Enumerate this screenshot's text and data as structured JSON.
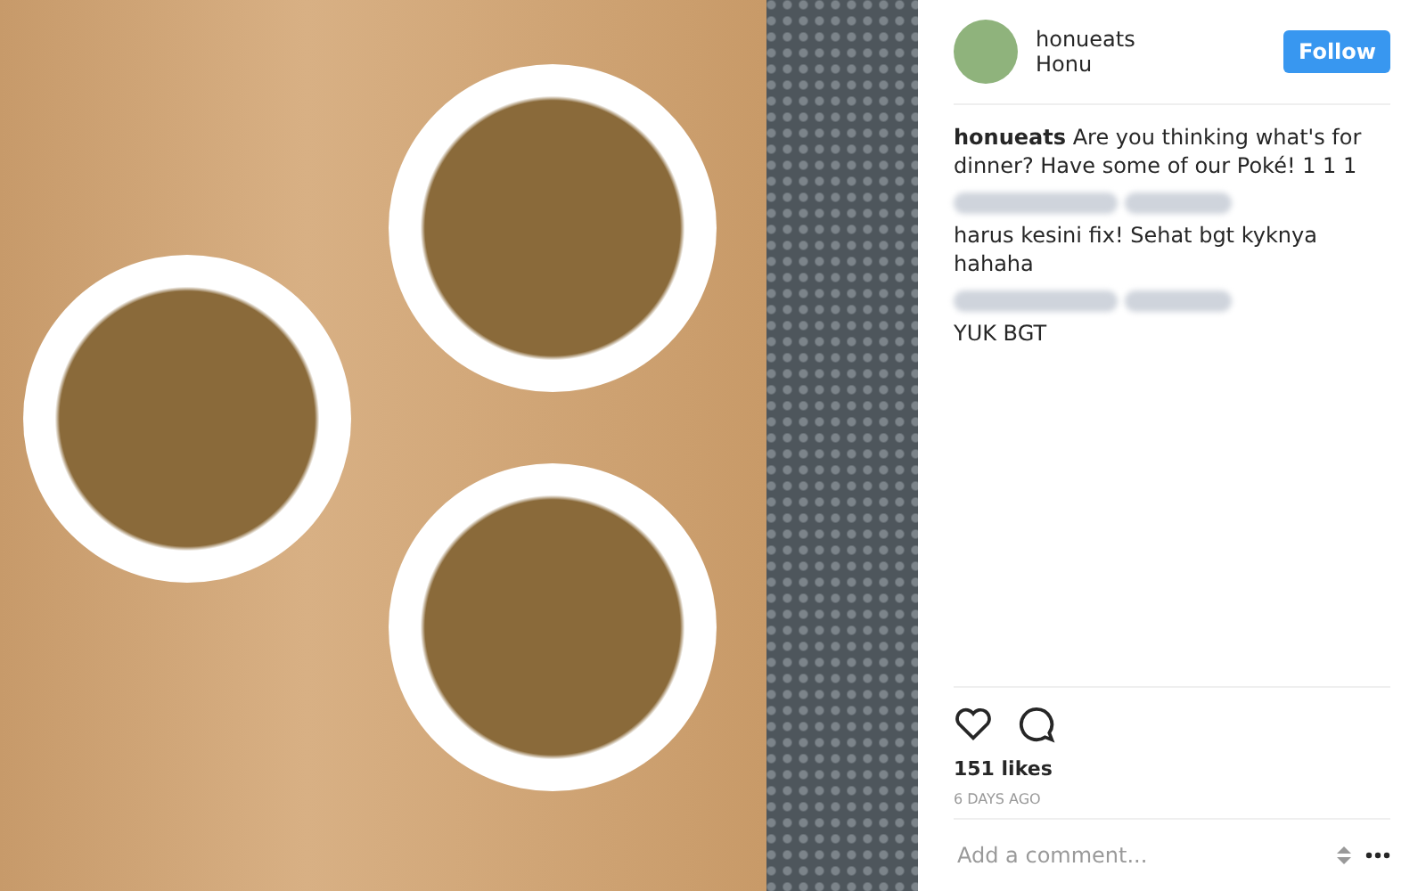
{
  "post": {
    "photo": {
      "kind": "photo"
    }
  },
  "header": {
    "username": "honueats",
    "location": "Honu",
    "follow_button": "Follow"
  },
  "caption": "**honueats** Are you thinking what's for dinner? Have some of our Poké! 1 1 1",
  "comments": [
    {
      "text": "harus kesini fix! Sehat bgt kyknya hahaha"
    },
    {
      "text": "YUK BGT"
    }
  ],
  "likes": "151 likes",
  "time": "6 DAYS AGO",
  "comment_field": {
    "placeholder": "Add a comment..."
  }
}
